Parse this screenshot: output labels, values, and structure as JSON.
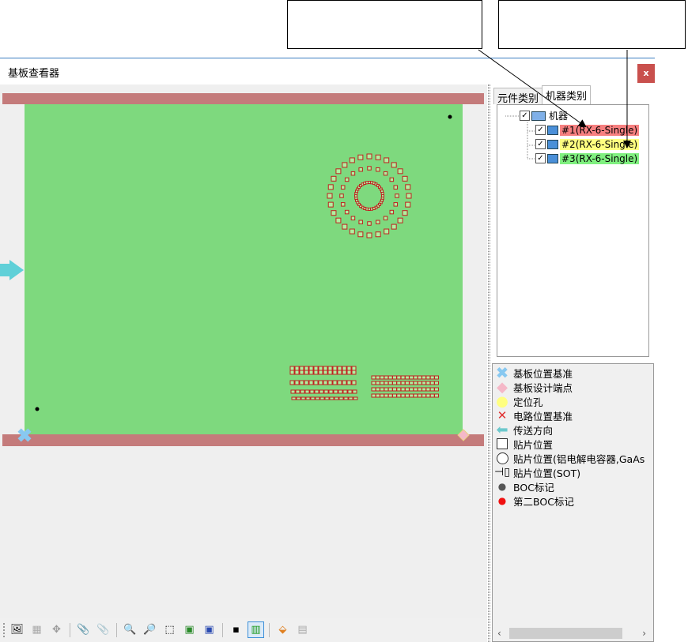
{
  "window": {
    "title": "基板查看器",
    "close_label": "x"
  },
  "tabs": [
    {
      "label": "元件类别"
    },
    {
      "label": "机器类别"
    }
  ],
  "tree": {
    "root": "机器",
    "machines": [
      {
        "label": "#1(RX-6-Single)",
        "color": "#f78080"
      },
      {
        "label": "#2(RX-6-Single)",
        "color": "#ffff80"
      },
      {
        "label": "#3(RX-6-Single)",
        "color": "#80f080"
      }
    ]
  },
  "legend": [
    {
      "label": "基板位置基准",
      "icon": "cross-icon"
    },
    {
      "label": "基板设计端点",
      "icon": "diamond-icon"
    },
    {
      "label": "定位孔",
      "icon": "circle-icon"
    },
    {
      "label": "电路位置基准",
      "icon": "x-icon"
    },
    {
      "label": "传送方向",
      "icon": "arrow-left-icon"
    },
    {
      "label": "贴片位置",
      "icon": "square-icon"
    },
    {
      "label": "贴片位置(铝电解电容器,GaAs",
      "icon": "round-icon"
    },
    {
      "label": "贴片位置(SOT)",
      "icon": "sot-icon"
    },
    {
      "label": "BOC标记",
      "icon": "dot-gray-icon"
    },
    {
      "label": "第二BOC标记",
      "icon": "dot-red-icon"
    }
  ],
  "colors": {
    "board": "#7ed97e",
    "rail": "#c47b7b",
    "accent": "#3c7fc1",
    "close": "#c9504d"
  }
}
